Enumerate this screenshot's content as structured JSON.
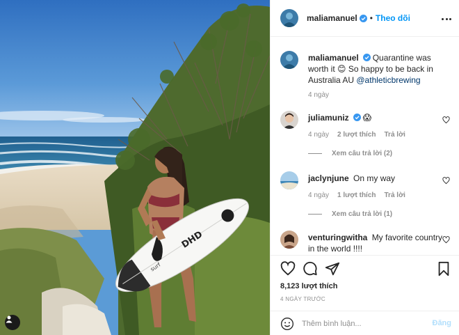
{
  "post": {
    "author": "maliamanuel",
    "follow_label": "Theo dõi",
    "more_icon": "more-horizontal-icon",
    "brand_color": "#0095f6"
  },
  "caption": {
    "username": "maliamanuel",
    "text": "Quarantine was worth it 😊 So happy to be back in Australia AU",
    "mention": "@athleticbrewing",
    "time": "4 ngày"
  },
  "comments": [
    {
      "username": "juliamuniz",
      "text": "😱",
      "time": "4 ngày",
      "likes": "2 lượt thích",
      "reply_label": "Trả lời",
      "view_replies": "Xem câu trả lời (2)"
    },
    {
      "username": "jaclynjune",
      "text": "On my way",
      "time": "4 ngày",
      "likes": "1 lượt thích",
      "reply_label": "Trả lời",
      "view_replies": "Xem câu trả lời (1)"
    },
    {
      "username": "venturingwitha",
      "text": "My favorite country in the world !!!!"
    }
  ],
  "actions": {
    "like_icon": "heart-icon",
    "comment_icon": "comment-icon",
    "share_icon": "share-icon",
    "save_icon": "bookmark-icon",
    "likes_count": "8,123 lượt thích",
    "timestamp": "4 NGÀY TRƯỚC"
  },
  "add_comment": {
    "placeholder": "Thêm bình luận...",
    "post_label": "Đăng",
    "emoji_icon": "emoji-icon"
  }
}
